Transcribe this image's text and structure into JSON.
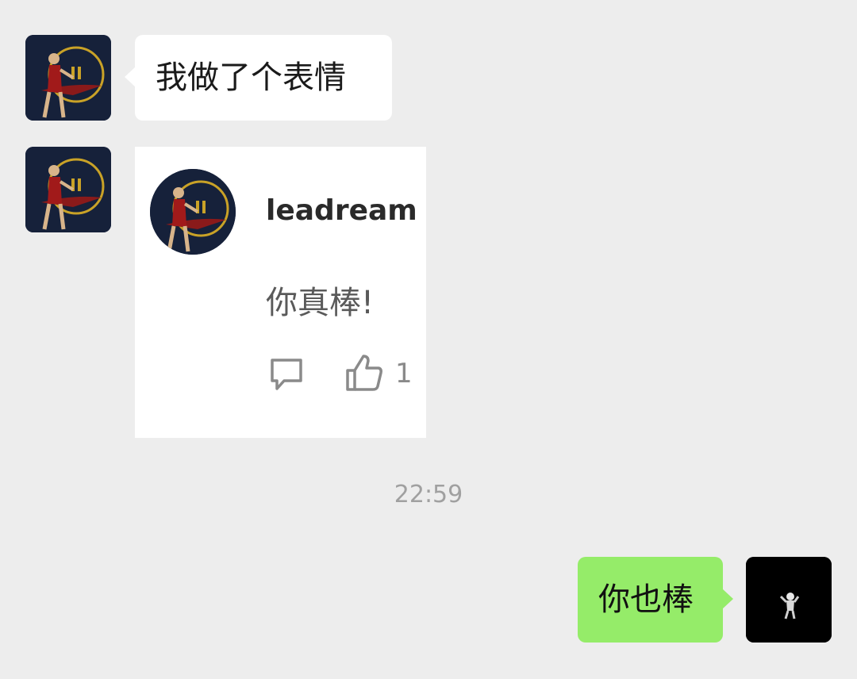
{
  "messages": [
    {
      "sender": "other",
      "type": "text",
      "text": "我做了个表情"
    },
    {
      "sender": "other",
      "type": "card",
      "card": {
        "username": "leadream",
        "comment": "你真棒!",
        "like_count": "1",
        "icons": [
          "comment-icon",
          "thumbs-up-icon"
        ]
      }
    },
    {
      "sender": "me",
      "type": "text",
      "text": "你也棒"
    }
  ],
  "timestamp": "22:59",
  "colors": {
    "background": "#ededed",
    "bubble_other": "#ffffff",
    "bubble_me": "#95ec69",
    "avatar_bg": "#16213a",
    "avatar_ring": "#c9a227"
  }
}
